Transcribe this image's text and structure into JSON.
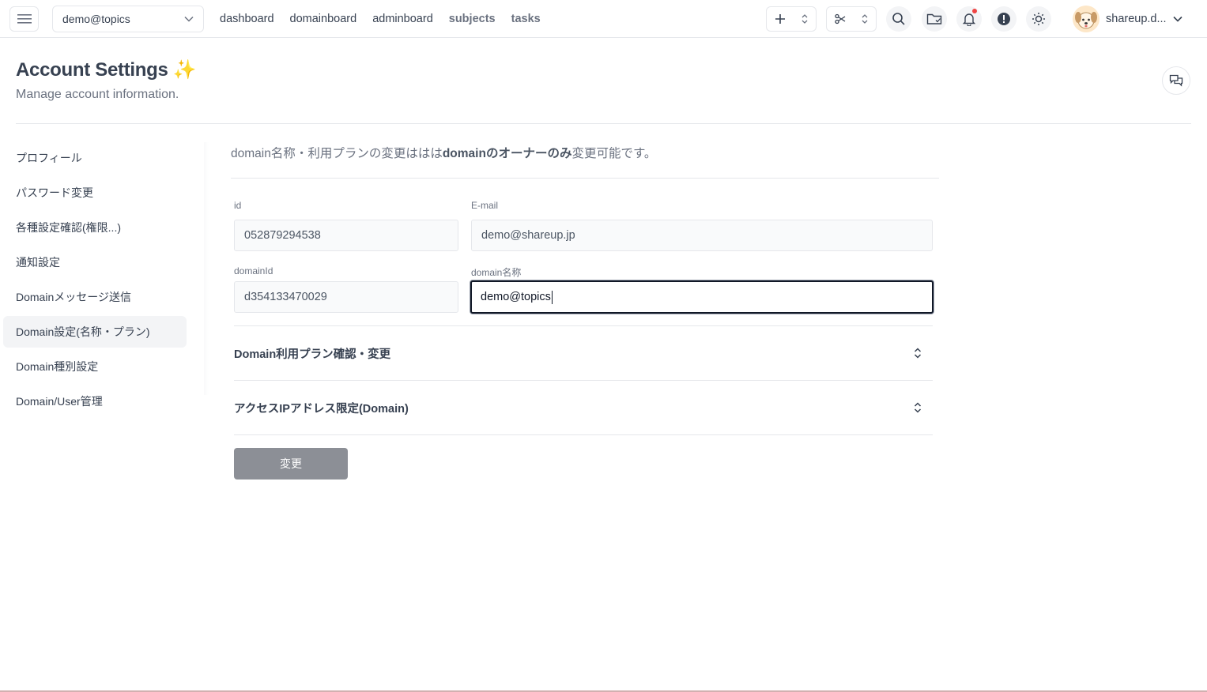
{
  "topbar": {
    "domain_selector": "demo@topics",
    "nav": [
      "dashboard",
      "domainboard",
      "adminboard",
      "subjects",
      "tasks"
    ],
    "user_name": "shareup.d...",
    "notification_dot_color": "#ef4444"
  },
  "header": {
    "title": "Account Settings ✨",
    "subtitle": "Manage account information."
  },
  "sidebar": {
    "items": [
      {
        "label": "プロフィール"
      },
      {
        "label": "パスワード変更"
      },
      {
        "label": "各種設定確認(権限...)"
      },
      {
        "label": "通知設定"
      },
      {
        "label": "Domainメッセージ送信"
      },
      {
        "label": "Domain設定(名称・プラン)",
        "active": true
      },
      {
        "label": "Domain種別設定"
      },
      {
        "label": "Domain/User管理"
      }
    ]
  },
  "main": {
    "notice_prefix": "domain名称・利用プランの変更ははは",
    "notice_bold": "domainのオーナーのみ",
    "notice_suffix": "変更可能です。",
    "fields": {
      "id": {
        "label": "id",
        "value": "052879294538"
      },
      "email": {
        "label": "E-mail",
        "value": "demo@shareup.jp"
      },
      "domain_id": {
        "label": "domainId",
        "value": "d354133470029"
      },
      "domain_name": {
        "label": "domain名称",
        "value": "demo@topics"
      }
    },
    "accordions": [
      {
        "label": "Domain利用プラン確認・変更"
      },
      {
        "label": "アクセスIPアドレス限定(Domain)"
      }
    ],
    "submit_label": "変更"
  }
}
